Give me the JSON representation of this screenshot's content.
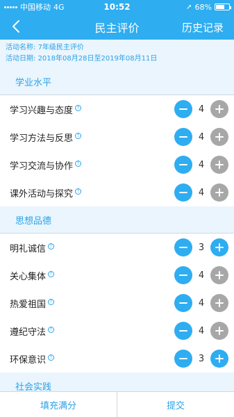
{
  "status_bar": {
    "carrier": "中国移动",
    "network": "4G",
    "time": "10:52",
    "battery_percent": "68%",
    "battery_level": 0.68
  },
  "nav": {
    "title": "民主评价",
    "history": "历史记录"
  },
  "activity": {
    "name_label": "活动名称:",
    "name": "7年级民主评价",
    "date_label": "活动日期:",
    "date": "2018年08月28日至2019年08月11日"
  },
  "sections": [
    {
      "title": "学业水平",
      "items": [
        {
          "label": "学习兴趣与态度",
          "value": "4",
          "max": false
        },
        {
          "label": "学习方法与反思",
          "value": "4",
          "max": false
        },
        {
          "label": "学习交流与协作",
          "value": "4",
          "max": false
        },
        {
          "label": "课外活动与探究",
          "value": "4",
          "max": false
        }
      ]
    },
    {
      "title": "思想品德",
      "items": [
        {
          "label": "明礼诚信",
          "value": "3",
          "max": false
        },
        {
          "label": "关心集体",
          "value": "4",
          "max": false
        },
        {
          "label": "热爱祖国",
          "value": "4",
          "max": false
        },
        {
          "label": "遵纪守法",
          "value": "4",
          "max": false
        },
        {
          "label": "环保意识",
          "value": "3",
          "max": false
        }
      ]
    },
    {
      "title": "社会实践",
      "items": []
    }
  ],
  "info_mark": "!",
  "bottom": {
    "fill_full": "填充满分",
    "submit": "提交"
  },
  "colors": {
    "accent": "#2eadf1",
    "section_bg": "#eaf5fd",
    "plus_disabled": "#a7a7a7"
  }
}
